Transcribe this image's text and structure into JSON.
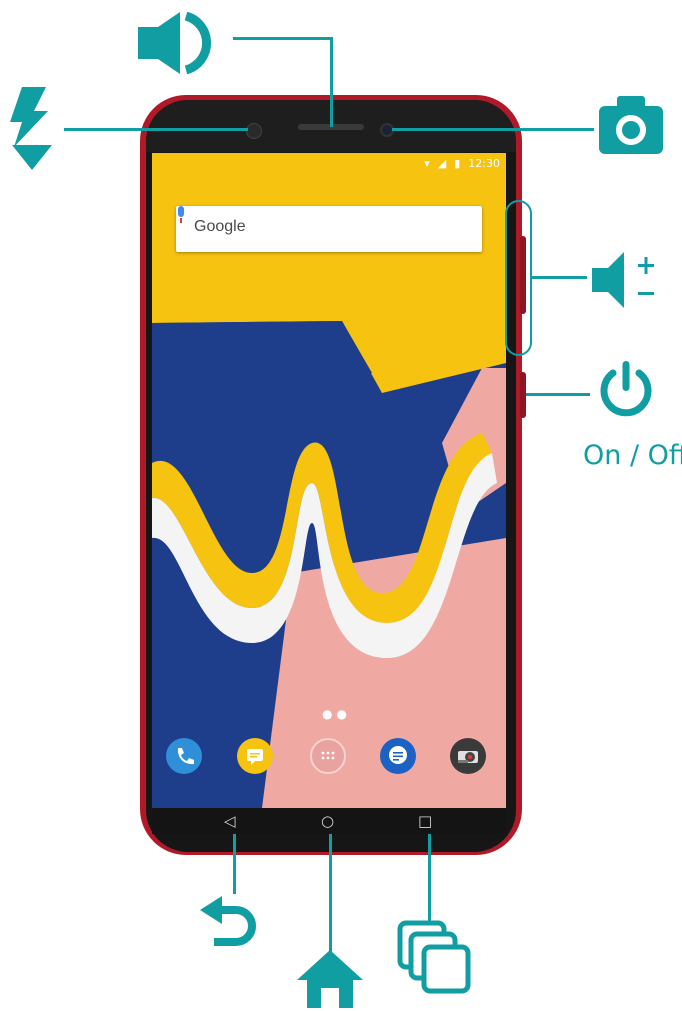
{
  "status_bar": {
    "time": "12:30"
  },
  "search_widget": {
    "logo_text": "Google"
  },
  "callouts": {
    "power_label": "On / Off"
  },
  "colors": {
    "accent_teal": "#119ea3",
    "phone_body_red": "#b01a28",
    "wallpaper_yellow": "#f6c310",
    "wallpaper_blue": "#1e3d8a",
    "wallpaper_pink": "#f0a9a2"
  },
  "dock": {
    "apps": [
      "phone-icon",
      "messages-icon",
      "app-drawer-icon",
      "sms-icon",
      "camera-icon"
    ]
  },
  "navbar": {
    "buttons": [
      "back-icon",
      "home-icon",
      "recents-icon"
    ]
  },
  "side_controls": [
    "speaker-icon",
    "flash-icon",
    "camera-icon",
    "volume-icon",
    "power-icon"
  ]
}
